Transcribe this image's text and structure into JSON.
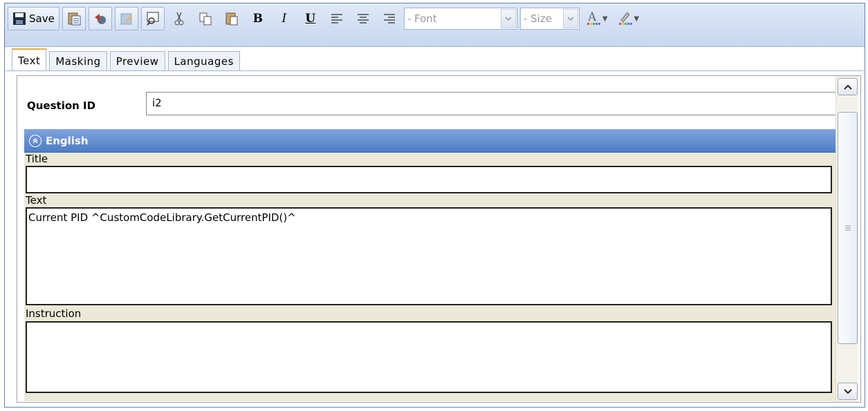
{
  "toolbar": {
    "save_label": "Save",
    "font_placeholder": "- Font",
    "size_placeholder": "- Size",
    "icons": [
      "save-icon",
      "paste-from-word-icon",
      "undo-icon",
      "edit-icon",
      "preview-icon",
      "cut-icon",
      "copy-icon",
      "paste-icon",
      "bold-icon",
      "italic-icon",
      "underline-icon",
      "align-left-icon",
      "align-center-icon",
      "align-right-icon",
      "font-color-icon",
      "highlight-icon"
    ]
  },
  "tabs": [
    {
      "label": "Text",
      "active": true
    },
    {
      "label": "Masking",
      "active": false
    },
    {
      "label": "Preview",
      "active": false
    },
    {
      "label": "Languages",
      "active": false
    }
  ],
  "question": {
    "id_label": "Question ID",
    "id_value": "i2"
  },
  "language_section": {
    "title": "English",
    "fields": {
      "title_label": "Title",
      "title_value": "",
      "text_label": "Text",
      "text_value": "Current PID ^CustomCodeLibrary.GetCurrentPID()^",
      "instruction_label": "Instruction",
      "instruction_value": ""
    }
  },
  "colors": {
    "header_blue": "#5b86c9",
    "active_tab_accent": "#f0a830",
    "panel_beige": "#ece9d8"
  }
}
